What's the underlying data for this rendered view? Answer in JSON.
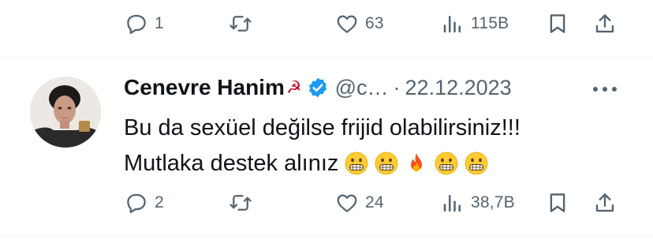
{
  "prev_tweet_actions": {
    "reply_count": "1",
    "repost_count": "",
    "like_count": "63",
    "views_count": "115B"
  },
  "tweet": {
    "display_name": "Cenevre Hanim",
    "name_emoji": "☭",
    "handle": "@c…",
    "separator": "·",
    "date": "22.12.2023",
    "text_line1": "Bu da sexüel değilse frijid olabilirsiniz!!!",
    "text_line2": "Mutlaka destek alınız",
    "emojis": [
      "grimacing",
      "grimacing",
      "fire",
      "grimacing",
      "grimacing"
    ],
    "actions": {
      "reply_count": "2",
      "repost_count": "",
      "like_count": "24",
      "views_count": "38,7B"
    }
  },
  "colors": {
    "icon_gray": "#536471",
    "text_dark": "#0f1419",
    "verified_blue": "#1d9bf0",
    "divider": "#eff3f4"
  }
}
